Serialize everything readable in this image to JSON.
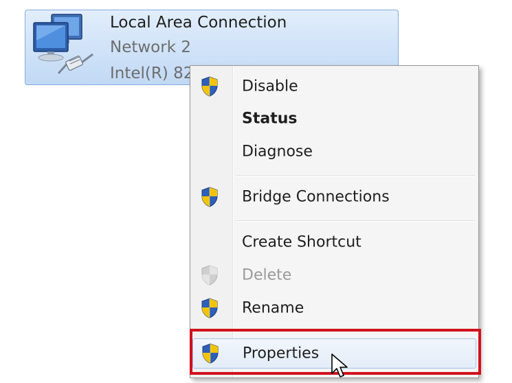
{
  "connection": {
    "name": "Local Area Connection",
    "network": "Network  2",
    "adapter": "Intel(R) 82"
  },
  "context_menu": {
    "items": [
      {
        "label": "Disable",
        "icon": "uac-shield-icon",
        "state": "normal"
      },
      {
        "label": "Status",
        "icon": null,
        "state": "default-bold"
      },
      {
        "label": "Diagnose",
        "icon": null,
        "state": "normal"
      },
      {
        "label": "Bridge Connections",
        "icon": "uac-shield-icon",
        "state": "normal"
      },
      {
        "label": "Create Shortcut",
        "icon": null,
        "state": "normal"
      },
      {
        "label": "Delete",
        "icon": "uac-shield-icon-disabled",
        "state": "disabled"
      },
      {
        "label": "Rename",
        "icon": "uac-shield-icon",
        "state": "normal"
      },
      {
        "label": "Properties",
        "icon": "uac-shield-icon",
        "state": "hovered"
      }
    ]
  },
  "annotation": {
    "highlighted_item": "Properties",
    "highlight_color": "#d0121b"
  },
  "colors": {
    "selection_fill": "#cfe2f8",
    "selection_border": "#84acdd",
    "menu_background": "#f5f5f5",
    "disabled_text": "#9a9a9a"
  }
}
